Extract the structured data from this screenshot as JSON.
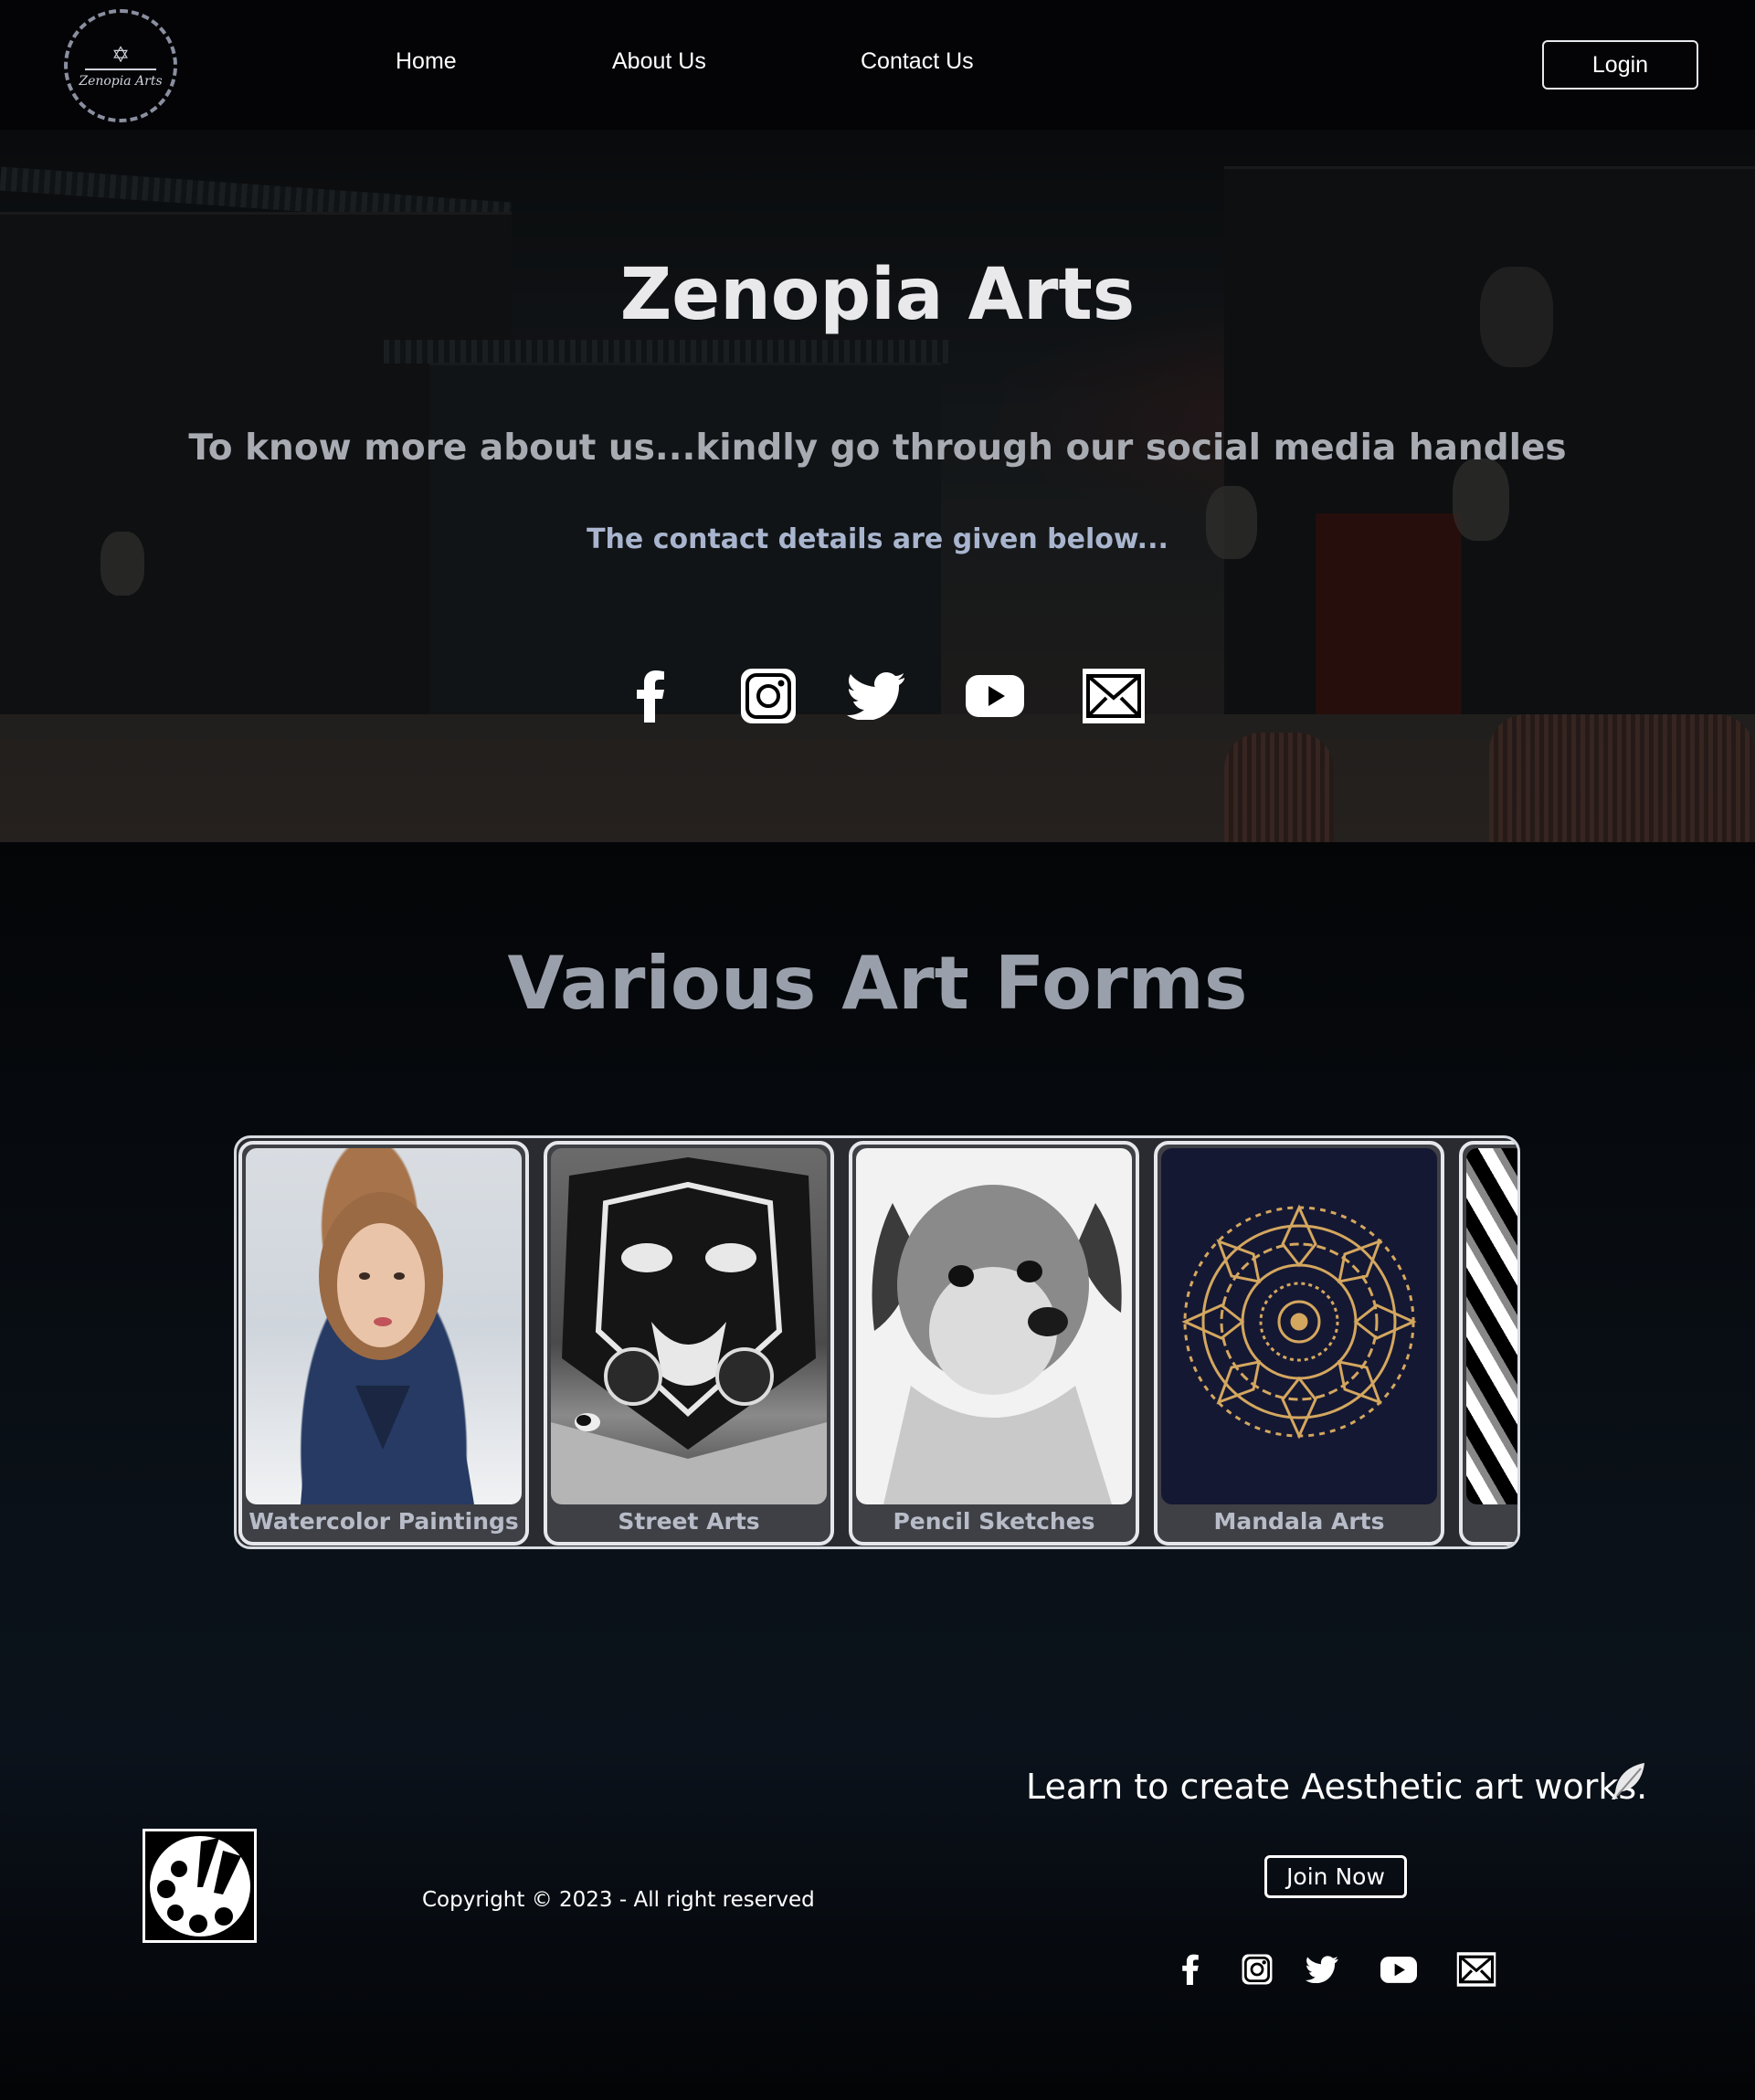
{
  "nav": {
    "logo_text": "Zenopia Arts",
    "links": [
      "Home",
      "About Us",
      "Contact Us"
    ],
    "login_label": "Login"
  },
  "hero": {
    "title": "Zenopia Arts",
    "subtitle": "To know more about us...kindly go through our social media handles",
    "note": "The contact details are given below...",
    "social_icons": [
      "facebook-icon",
      "instagram-icon",
      "twitter-icon",
      "youtube-icon",
      "mail-icon"
    ]
  },
  "art_forms": {
    "title": "Various Art Forms",
    "cards": [
      {
        "caption": "Watercolor Paintings",
        "image": "watercolor girl portrait"
      },
      {
        "caption": "Street Arts",
        "image": "tiger mural street art"
      },
      {
        "caption": "Pencil Sketches",
        "image": "puppy pencil sketch"
      },
      {
        "caption": "Mandala Arts",
        "image": "gold mandala"
      },
      {
        "caption": "",
        "image": "optical illusion pattern (partial)"
      }
    ]
  },
  "footer": {
    "copyright": "Copyright © 2023 - All right reserved",
    "tagline": "Learn to create Aesthetic art works.",
    "join_label": "Join Now",
    "social_icons": [
      "facebook-icon",
      "instagram-icon",
      "twitter-icon",
      "youtube-icon",
      "mail-icon"
    ]
  },
  "colors": {
    "background": "#04050a",
    "heading_gray": "#9aa0ab",
    "accent_blue_gray": "#a9b5ce"
  }
}
